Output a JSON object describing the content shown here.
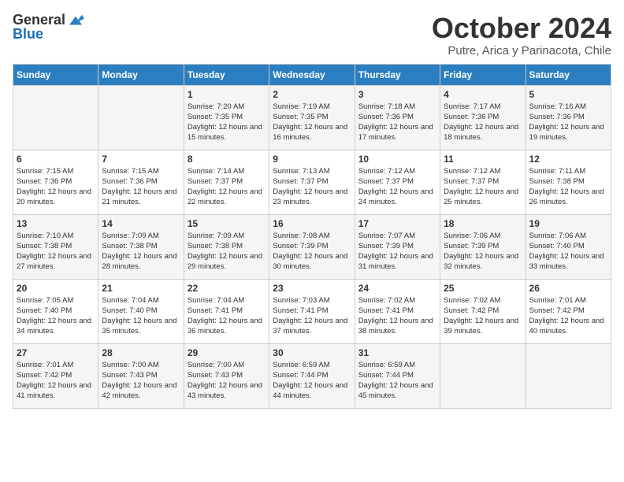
{
  "header": {
    "logo_general": "General",
    "logo_blue": "Blue",
    "month_title": "October 2024",
    "location": "Putre, Arica y Parinacota, Chile"
  },
  "days_of_week": [
    "Sunday",
    "Monday",
    "Tuesday",
    "Wednesday",
    "Thursday",
    "Friday",
    "Saturday"
  ],
  "weeks": [
    [
      {
        "day": "",
        "sunrise": "",
        "sunset": "",
        "daylight": ""
      },
      {
        "day": "",
        "sunrise": "",
        "sunset": "",
        "daylight": ""
      },
      {
        "day": "1",
        "sunrise": "Sunrise: 7:20 AM",
        "sunset": "Sunset: 7:35 PM",
        "daylight": "Daylight: 12 hours and 15 minutes."
      },
      {
        "day": "2",
        "sunrise": "Sunrise: 7:19 AM",
        "sunset": "Sunset: 7:35 PM",
        "daylight": "Daylight: 12 hours and 16 minutes."
      },
      {
        "day": "3",
        "sunrise": "Sunrise: 7:18 AM",
        "sunset": "Sunset: 7:36 PM",
        "daylight": "Daylight: 12 hours and 17 minutes."
      },
      {
        "day": "4",
        "sunrise": "Sunrise: 7:17 AM",
        "sunset": "Sunset: 7:36 PM",
        "daylight": "Daylight: 12 hours and 18 minutes."
      },
      {
        "day": "5",
        "sunrise": "Sunrise: 7:16 AM",
        "sunset": "Sunset: 7:36 PM",
        "daylight": "Daylight: 12 hours and 19 minutes."
      }
    ],
    [
      {
        "day": "6",
        "sunrise": "Sunrise: 7:15 AM",
        "sunset": "Sunset: 7:36 PM",
        "daylight": "Daylight: 12 hours and 20 minutes."
      },
      {
        "day": "7",
        "sunrise": "Sunrise: 7:15 AM",
        "sunset": "Sunset: 7:36 PM",
        "daylight": "Daylight: 12 hours and 21 minutes."
      },
      {
        "day": "8",
        "sunrise": "Sunrise: 7:14 AM",
        "sunset": "Sunset: 7:37 PM",
        "daylight": "Daylight: 12 hours and 22 minutes."
      },
      {
        "day": "9",
        "sunrise": "Sunrise: 7:13 AM",
        "sunset": "Sunset: 7:37 PM",
        "daylight": "Daylight: 12 hours and 23 minutes."
      },
      {
        "day": "10",
        "sunrise": "Sunrise: 7:12 AM",
        "sunset": "Sunset: 7:37 PM",
        "daylight": "Daylight: 12 hours and 24 minutes."
      },
      {
        "day": "11",
        "sunrise": "Sunrise: 7:12 AM",
        "sunset": "Sunset: 7:37 PM",
        "daylight": "Daylight: 12 hours and 25 minutes."
      },
      {
        "day": "12",
        "sunrise": "Sunrise: 7:11 AM",
        "sunset": "Sunset: 7:38 PM",
        "daylight": "Daylight: 12 hours and 26 minutes."
      }
    ],
    [
      {
        "day": "13",
        "sunrise": "Sunrise: 7:10 AM",
        "sunset": "Sunset: 7:38 PM",
        "daylight": "Daylight: 12 hours and 27 minutes."
      },
      {
        "day": "14",
        "sunrise": "Sunrise: 7:09 AM",
        "sunset": "Sunset: 7:38 PM",
        "daylight": "Daylight: 12 hours and 28 minutes."
      },
      {
        "day": "15",
        "sunrise": "Sunrise: 7:09 AM",
        "sunset": "Sunset: 7:38 PM",
        "daylight": "Daylight: 12 hours and 29 minutes."
      },
      {
        "day": "16",
        "sunrise": "Sunrise: 7:08 AM",
        "sunset": "Sunset: 7:39 PM",
        "daylight": "Daylight: 12 hours and 30 minutes."
      },
      {
        "day": "17",
        "sunrise": "Sunrise: 7:07 AM",
        "sunset": "Sunset: 7:39 PM",
        "daylight": "Daylight: 12 hours and 31 minutes."
      },
      {
        "day": "18",
        "sunrise": "Sunrise: 7:06 AM",
        "sunset": "Sunset: 7:39 PM",
        "daylight": "Daylight: 12 hours and 32 minutes."
      },
      {
        "day": "19",
        "sunrise": "Sunrise: 7:06 AM",
        "sunset": "Sunset: 7:40 PM",
        "daylight": "Daylight: 12 hours and 33 minutes."
      }
    ],
    [
      {
        "day": "20",
        "sunrise": "Sunrise: 7:05 AM",
        "sunset": "Sunset: 7:40 PM",
        "daylight": "Daylight: 12 hours and 34 minutes."
      },
      {
        "day": "21",
        "sunrise": "Sunrise: 7:04 AM",
        "sunset": "Sunset: 7:40 PM",
        "daylight": "Daylight: 12 hours and 35 minutes."
      },
      {
        "day": "22",
        "sunrise": "Sunrise: 7:04 AM",
        "sunset": "Sunset: 7:41 PM",
        "daylight": "Daylight: 12 hours and 36 minutes."
      },
      {
        "day": "23",
        "sunrise": "Sunrise: 7:03 AM",
        "sunset": "Sunset: 7:41 PM",
        "daylight": "Daylight: 12 hours and 37 minutes."
      },
      {
        "day": "24",
        "sunrise": "Sunrise: 7:02 AM",
        "sunset": "Sunset: 7:41 PM",
        "daylight": "Daylight: 12 hours and 38 minutes."
      },
      {
        "day": "25",
        "sunrise": "Sunrise: 7:02 AM",
        "sunset": "Sunset: 7:42 PM",
        "daylight": "Daylight: 12 hours and 39 minutes."
      },
      {
        "day": "26",
        "sunrise": "Sunrise: 7:01 AM",
        "sunset": "Sunset: 7:42 PM",
        "daylight": "Daylight: 12 hours and 40 minutes."
      }
    ],
    [
      {
        "day": "27",
        "sunrise": "Sunrise: 7:01 AM",
        "sunset": "Sunset: 7:42 PM",
        "daylight": "Daylight: 12 hours and 41 minutes."
      },
      {
        "day": "28",
        "sunrise": "Sunrise: 7:00 AM",
        "sunset": "Sunset: 7:43 PM",
        "daylight": "Daylight: 12 hours and 42 minutes."
      },
      {
        "day": "29",
        "sunrise": "Sunrise: 7:00 AM",
        "sunset": "Sunset: 7:43 PM",
        "daylight": "Daylight: 12 hours and 43 minutes."
      },
      {
        "day": "30",
        "sunrise": "Sunrise: 6:59 AM",
        "sunset": "Sunset: 7:44 PM",
        "daylight": "Daylight: 12 hours and 44 minutes."
      },
      {
        "day": "31",
        "sunrise": "Sunrise: 6:59 AM",
        "sunset": "Sunset: 7:44 PM",
        "daylight": "Daylight: 12 hours and 45 minutes."
      },
      {
        "day": "",
        "sunrise": "",
        "sunset": "",
        "daylight": ""
      },
      {
        "day": "",
        "sunrise": "",
        "sunset": "",
        "daylight": ""
      }
    ]
  ]
}
